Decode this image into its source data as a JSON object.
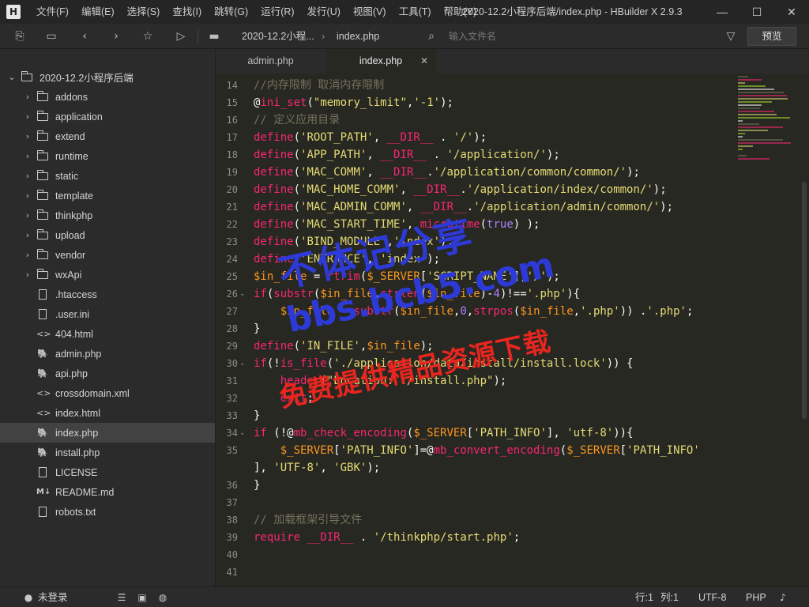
{
  "app": {
    "logo_letter": "H",
    "title": "2020-12.2小程序后端/index.php - HBuilder X 2.9.3",
    "menus": [
      "文件(F)",
      "编辑(E)",
      "选择(S)",
      "查找(I)",
      "跳转(G)",
      "运行(R)",
      "发行(U)",
      "视图(V)",
      "工具(T)",
      "帮助(Y)"
    ]
  },
  "toolbar": {
    "breadcrumb_project": "2020-12.2小程...",
    "breadcrumb_file": "index.php",
    "search_placeholder": "输入文件名",
    "preview_label": "预览",
    "icons": [
      "new-file-icon",
      "save-icon",
      "back-icon",
      "forward-icon",
      "bookmark-star-icon",
      "run-icon",
      "folder-icon",
      "file-search-icon",
      "filter-icon"
    ]
  },
  "sidebar": {
    "project": "2020-12.2小程序后端",
    "folders": [
      "addons",
      "application",
      "extend",
      "runtime",
      "static",
      "template",
      "thinkphp",
      "upload",
      "vendor",
      "wxApi"
    ],
    "files": [
      ".htaccess",
      ".user.ini",
      "404.html",
      "admin.php",
      "api.php",
      "crossdomain.xml",
      "index.html",
      "index.php",
      "install.php",
      "LICENSE",
      "README.md",
      "robots.txt"
    ],
    "active_file": "index.php"
  },
  "tabs": [
    {
      "label": "admin.php"
    },
    {
      "label": "index.php"
    }
  ],
  "code": [
    {
      "n": "14",
      "t": "//内存限制 取消内存限制"
    },
    {
      "n": "15",
      "t": "@ini_set(\"memory_limit\",'-1');"
    },
    {
      "n": "16",
      "t": "// 定义应用目录"
    },
    {
      "n": "17",
      "t": "define('ROOT_PATH', __DIR__ . '/');"
    },
    {
      "n": "18",
      "t": "define('APP_PATH', __DIR__ . '/application/');"
    },
    {
      "n": "19",
      "t": "define('MAC_COMM', __DIR__.'/application/common/common/');"
    },
    {
      "n": "20",
      "t": "define('MAC_HOME_COMM', __DIR__.'/application/index/common/');"
    },
    {
      "n": "21",
      "t": "define('MAC_ADMIN_COMM', __DIR__.'/application/admin/common/');"
    },
    {
      "n": "22",
      "t": "define('MAC_START_TIME', microtime(true) );"
    },
    {
      "n": "23",
      "t": "define('BIND_MODULE','index');"
    },
    {
      "n": "24",
      "t": "define('ENTRANCE', 'index');"
    },
    {
      "n": "25",
      "t": "$in_file = rtrim($_SERVER['SCRIPT_NAME'],'/');"
    },
    {
      "n": "26",
      "t": "if(substr($in_file,strlen($in_file)-4)!=='.php'){"
    },
    {
      "n": "27",
      "t": "    $in_file = substr($in_file,0,strpos($in_file,'.php')) .'.php';"
    },
    {
      "n": "28",
      "t": "}"
    },
    {
      "n": "29",
      "t": "define('IN_FILE',$in_file);"
    },
    {
      "n": "30",
      "t": "if(!is_file('./application/data/install/install.lock')) {"
    },
    {
      "n": "31",
      "t": "    header(\"Location: ./install.php\");"
    },
    {
      "n": "32",
      "t": "    exit;"
    },
    {
      "n": "33",
      "t": "}"
    },
    {
      "n": "34",
      "t": "if (!@mb_check_encoding($_SERVER['PATH_INFO'], 'utf-8')){"
    },
    {
      "n": "35",
      "t": "    $_SERVER['PATH_INFO']=@mb_convert_encoding($_SERVER['PATH_INFO'"
    },
    {
      "n": "",
      "t": "], 'UTF-8', 'GBK');"
    },
    {
      "n": "36",
      "t": "}"
    },
    {
      "n": "37",
      "t": ""
    },
    {
      "n": "38",
      "t": "// 加载框架引导文件"
    },
    {
      "n": "39",
      "t": "require __DIR__ . '/thinkphp/start.php';"
    },
    {
      "n": "40",
      "t": ""
    },
    {
      "n": "41",
      "t": ""
    }
  ],
  "watermark": {
    "line1": "不体记分享",
    "line2": "bbs.bcb5.com",
    "line3": "免费提供精品资源下载"
  },
  "statusbar": {
    "login": "未登录",
    "row": "行:1",
    "col": "列:1",
    "encoding": "UTF-8",
    "language": "PHP"
  },
  "colors": {
    "editor_bg": "#272822",
    "sidebar_bg": "#2b2b2b",
    "comment": "#75715e",
    "keyword": "#f92672",
    "string": "#e6db74",
    "watermark_blue": "#2d3ad8",
    "watermark_red": "#e8261f"
  }
}
